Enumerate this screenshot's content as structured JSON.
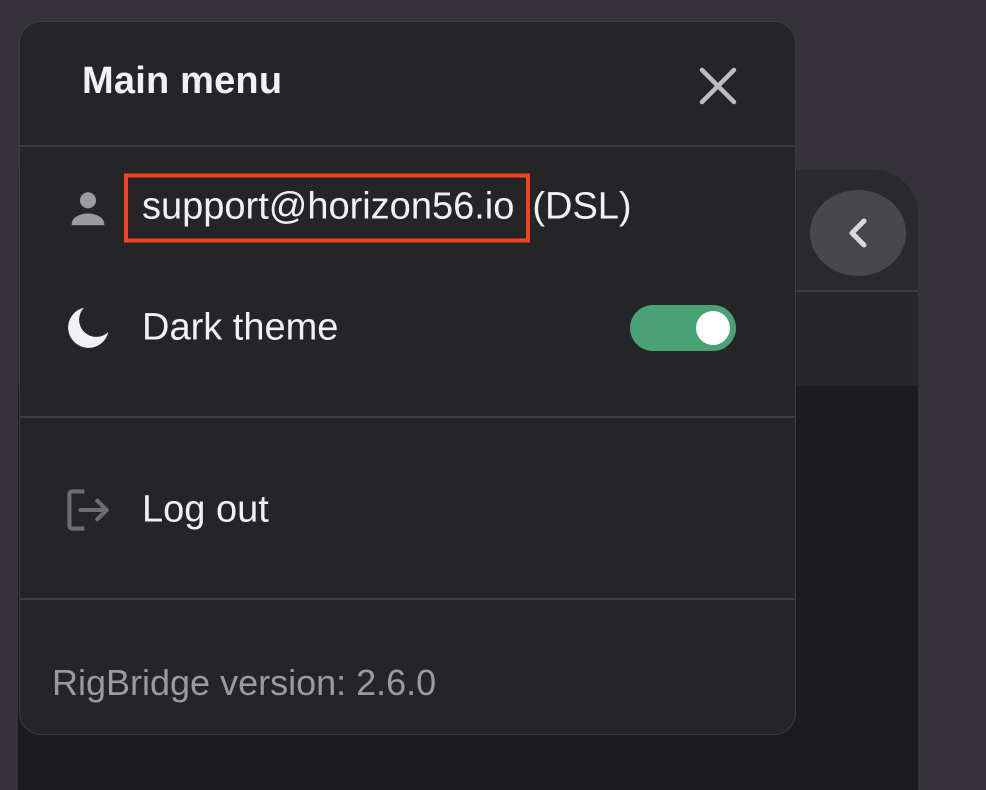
{
  "menu": {
    "title": "Main menu",
    "close_icon": "close-icon"
  },
  "user": {
    "icon": "person-icon",
    "email": "support@horizon56.io",
    "suffix": "(DSL)"
  },
  "theme": {
    "icon": "moon-icon",
    "label": "Dark theme",
    "toggle_on": true,
    "toggle_color": "#4aa274"
  },
  "logout": {
    "icon": "logout-icon",
    "label": "Log out"
  },
  "footer": {
    "version_label": "RigBridge version: 2.6.0"
  },
  "background": {
    "collapse_icon": "chevron-left-icon"
  },
  "colors": {
    "highlight": "#f2451d"
  }
}
